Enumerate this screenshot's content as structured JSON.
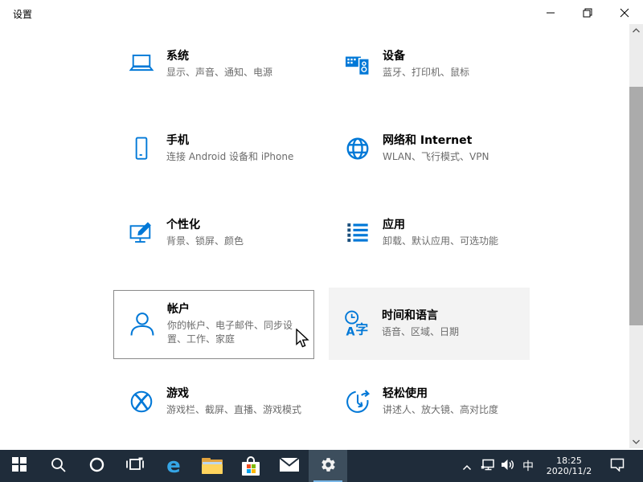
{
  "window": {
    "title": "设置",
    "controls": [
      {
        "name": "minimize",
        "icon": "minimize-icon"
      },
      {
        "name": "restore",
        "icon": "restore-icon"
      },
      {
        "name": "close",
        "icon": "close-icon"
      }
    ]
  },
  "colors": {
    "accent": "#0078d7",
    "taskbar_bg": "#1f2c3a",
    "taskbar_active_bg": "#3d4e5d",
    "taskbar_active_underline": "#7ab8e8",
    "tile_subtitle": "#6b6b6b",
    "tile_hover_border": "#8a8a8a",
    "scrollbar_track": "#ececec",
    "scrollbar_thumb": "#ababab"
  },
  "tiles": [
    {
      "title": "系统",
      "subtitle": "显示、声音、通知、电源",
      "icon": "laptop-icon"
    },
    {
      "title": "设备",
      "subtitle": "蓝牙、打印机、鼠标",
      "icon": "devices-icon"
    },
    {
      "title": "手机",
      "subtitle": "连接 Android 设备和 iPhone",
      "icon": "phone-icon"
    },
    {
      "title": "网络和 Internet",
      "subtitle": "WLAN、飞行模式、VPN",
      "icon": "globe-icon"
    },
    {
      "title": "个性化",
      "subtitle": "背景、锁屏、颜色",
      "icon": "personalization-icon"
    },
    {
      "title": "应用",
      "subtitle": "卸载、默认应用、可选功能",
      "icon": "apps-list-icon"
    },
    {
      "title": "帐户",
      "subtitle": "你的帐户、电子邮件、同步设置、工作、家庭",
      "icon": "person-icon",
      "highlighted": true
    },
    {
      "title": "时间和语言",
      "subtitle": "语音、区域、日期",
      "icon": "time-language-icon"
    },
    {
      "title": "游戏",
      "subtitle": "游戏栏、截屏、直播、游戏模式",
      "icon": "xbox-icon"
    },
    {
      "title": "轻松使用",
      "subtitle": "讲述人、放大镜、高对比度",
      "icon": "ease-of-access-icon"
    }
  ],
  "taskbar": {
    "buttons": [
      {
        "icon": "start-icon"
      },
      {
        "icon": "search-icon"
      },
      {
        "icon": "cortana-icon"
      },
      {
        "icon": "task-view-icon"
      },
      {
        "icon": "edge-icon",
        "glyph": "e"
      },
      {
        "icon": "file-explorer-icon"
      },
      {
        "icon": "store-icon"
      },
      {
        "icon": "mail-icon"
      },
      {
        "icon": "settings-gear-icon",
        "active": true
      }
    ],
    "tray": {
      "hidden_icons": "chevron-up-icon",
      "network": "network-icon",
      "volume": "speaker-icon",
      "ime": "中",
      "time": "18:25",
      "date": "2020/11/2",
      "action_center": "action-center-icon"
    }
  }
}
